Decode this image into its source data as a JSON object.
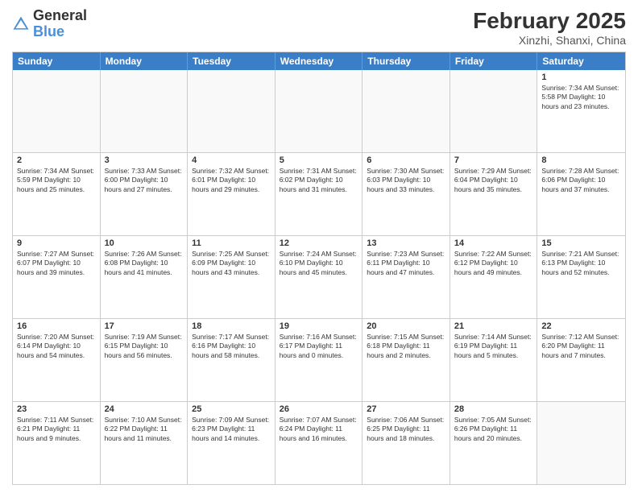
{
  "header": {
    "logo_general": "General",
    "logo_blue": "Blue",
    "month_year": "February 2025",
    "location": "Xinzhi, Shanxi, China"
  },
  "weekdays": [
    "Sunday",
    "Monday",
    "Tuesday",
    "Wednesday",
    "Thursday",
    "Friday",
    "Saturday"
  ],
  "rows": [
    [
      {
        "day": "",
        "info": ""
      },
      {
        "day": "",
        "info": ""
      },
      {
        "day": "",
        "info": ""
      },
      {
        "day": "",
        "info": ""
      },
      {
        "day": "",
        "info": ""
      },
      {
        "day": "",
        "info": ""
      },
      {
        "day": "1",
        "info": "Sunrise: 7:34 AM\nSunset: 5:58 PM\nDaylight: 10 hours and 23 minutes."
      }
    ],
    [
      {
        "day": "2",
        "info": "Sunrise: 7:34 AM\nSunset: 5:59 PM\nDaylight: 10 hours and 25 minutes."
      },
      {
        "day": "3",
        "info": "Sunrise: 7:33 AM\nSunset: 6:00 PM\nDaylight: 10 hours and 27 minutes."
      },
      {
        "day": "4",
        "info": "Sunrise: 7:32 AM\nSunset: 6:01 PM\nDaylight: 10 hours and 29 minutes."
      },
      {
        "day": "5",
        "info": "Sunrise: 7:31 AM\nSunset: 6:02 PM\nDaylight: 10 hours and 31 minutes."
      },
      {
        "day": "6",
        "info": "Sunrise: 7:30 AM\nSunset: 6:03 PM\nDaylight: 10 hours and 33 minutes."
      },
      {
        "day": "7",
        "info": "Sunrise: 7:29 AM\nSunset: 6:04 PM\nDaylight: 10 hours and 35 minutes."
      },
      {
        "day": "8",
        "info": "Sunrise: 7:28 AM\nSunset: 6:06 PM\nDaylight: 10 hours and 37 minutes."
      }
    ],
    [
      {
        "day": "9",
        "info": "Sunrise: 7:27 AM\nSunset: 6:07 PM\nDaylight: 10 hours and 39 minutes."
      },
      {
        "day": "10",
        "info": "Sunrise: 7:26 AM\nSunset: 6:08 PM\nDaylight: 10 hours and 41 minutes."
      },
      {
        "day": "11",
        "info": "Sunrise: 7:25 AM\nSunset: 6:09 PM\nDaylight: 10 hours and 43 minutes."
      },
      {
        "day": "12",
        "info": "Sunrise: 7:24 AM\nSunset: 6:10 PM\nDaylight: 10 hours and 45 minutes."
      },
      {
        "day": "13",
        "info": "Sunrise: 7:23 AM\nSunset: 6:11 PM\nDaylight: 10 hours and 47 minutes."
      },
      {
        "day": "14",
        "info": "Sunrise: 7:22 AM\nSunset: 6:12 PM\nDaylight: 10 hours and 49 minutes."
      },
      {
        "day": "15",
        "info": "Sunrise: 7:21 AM\nSunset: 6:13 PM\nDaylight: 10 hours and 52 minutes."
      }
    ],
    [
      {
        "day": "16",
        "info": "Sunrise: 7:20 AM\nSunset: 6:14 PM\nDaylight: 10 hours and 54 minutes."
      },
      {
        "day": "17",
        "info": "Sunrise: 7:19 AM\nSunset: 6:15 PM\nDaylight: 10 hours and 56 minutes."
      },
      {
        "day": "18",
        "info": "Sunrise: 7:17 AM\nSunset: 6:16 PM\nDaylight: 10 hours and 58 minutes."
      },
      {
        "day": "19",
        "info": "Sunrise: 7:16 AM\nSunset: 6:17 PM\nDaylight: 11 hours and 0 minutes."
      },
      {
        "day": "20",
        "info": "Sunrise: 7:15 AM\nSunset: 6:18 PM\nDaylight: 11 hours and 2 minutes."
      },
      {
        "day": "21",
        "info": "Sunrise: 7:14 AM\nSunset: 6:19 PM\nDaylight: 11 hours and 5 minutes."
      },
      {
        "day": "22",
        "info": "Sunrise: 7:12 AM\nSunset: 6:20 PM\nDaylight: 11 hours and 7 minutes."
      }
    ],
    [
      {
        "day": "23",
        "info": "Sunrise: 7:11 AM\nSunset: 6:21 PM\nDaylight: 11 hours and 9 minutes."
      },
      {
        "day": "24",
        "info": "Sunrise: 7:10 AM\nSunset: 6:22 PM\nDaylight: 11 hours and 11 minutes."
      },
      {
        "day": "25",
        "info": "Sunrise: 7:09 AM\nSunset: 6:23 PM\nDaylight: 11 hours and 14 minutes."
      },
      {
        "day": "26",
        "info": "Sunrise: 7:07 AM\nSunset: 6:24 PM\nDaylight: 11 hours and 16 minutes."
      },
      {
        "day": "27",
        "info": "Sunrise: 7:06 AM\nSunset: 6:25 PM\nDaylight: 11 hours and 18 minutes."
      },
      {
        "day": "28",
        "info": "Sunrise: 7:05 AM\nSunset: 6:26 PM\nDaylight: 11 hours and 20 minutes."
      },
      {
        "day": "",
        "info": ""
      }
    ]
  ]
}
